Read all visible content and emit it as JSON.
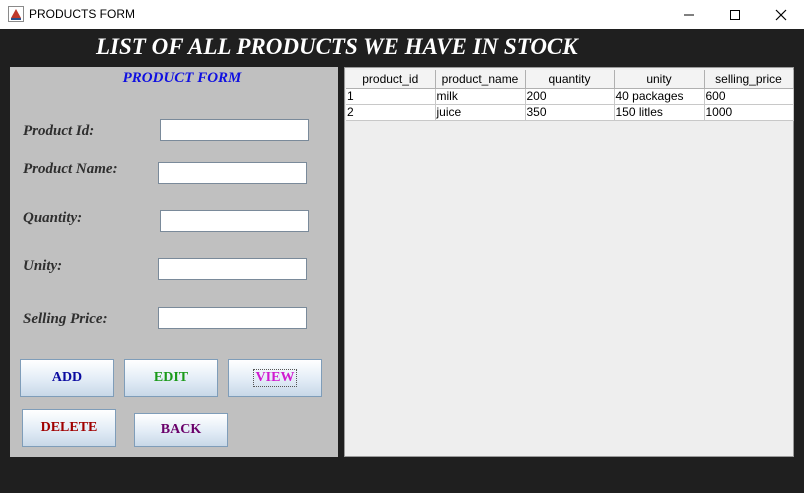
{
  "window": {
    "title": "PRODUCTS FORM",
    "app_icon": "java-cup-icon"
  },
  "heading": "LIST OF ALL PRODUCTS WE HAVE IN STOCK",
  "form": {
    "title": "PRODUCT  FORM",
    "labels": {
      "product_id": "Product Id:",
      "product_name": "Product Name:",
      "quantity": "Quantity:",
      "unity": "Unity:",
      "selling_price": "Selling Price:"
    },
    "values": {
      "product_id": "",
      "product_name": "",
      "quantity": "",
      "unity": "",
      "selling_price": ""
    }
  },
  "buttons": {
    "add": "ADD",
    "edit": "EDIT",
    "view": "VIEW",
    "delete": "DELETE",
    "back": "BACK"
  },
  "colors": {
    "add": "#0a0aa0",
    "edit": "#1a9a1a",
    "view": "#d01ad0",
    "delete": "#a00000",
    "back": "#6a006a",
    "form_title": "#1010e0"
  },
  "table": {
    "columns": [
      "product_id",
      "product_name",
      "quantity",
      "unity",
      "selling_price"
    ],
    "rows": [
      [
        "1",
        "milk",
        "200",
        "40 packages",
        "600"
      ],
      [
        "2",
        "juice",
        "350",
        "150 litles",
        "1000"
      ]
    ]
  }
}
